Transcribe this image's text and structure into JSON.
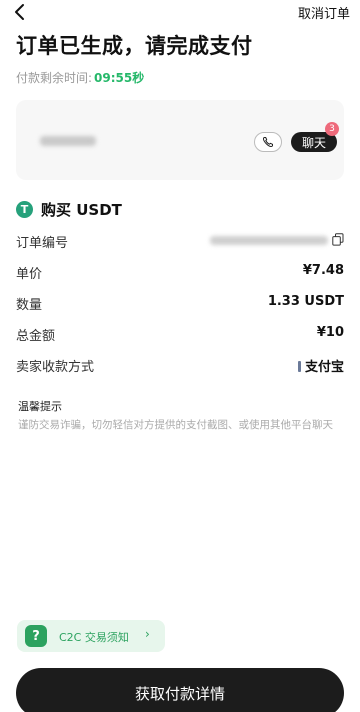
{
  "nav": {
    "back_icon": "chevron-left-icon",
    "cancel_label": "取消订单"
  },
  "header": {
    "title": "订单已生成，请完成支付",
    "timer_label": "付款剩余时间:",
    "timer_value": "09:55秒"
  },
  "seller": {
    "phone_icon": "phone-icon",
    "chat_label": "聊天",
    "chat_badge": "3"
  },
  "order": {
    "title": "购买 USDT",
    "asset_icon": "tether-icon",
    "asset_symbol": "T",
    "rows": [
      {
        "label": "订单编号",
        "value": ""
      },
      {
        "label": "单价",
        "value": "¥7.48"
      },
      {
        "label": "数量",
        "value": "1.33 USDT"
      },
      {
        "label": "总金额",
        "value": "¥10"
      },
      {
        "label": "卖家收款方式",
        "value": "支付宝"
      }
    ]
  },
  "tips": {
    "title": "温馨提示",
    "text": "谨防交易诈骗，切勿轻信对方提供的支付截图、或使用其他平台聊天"
  },
  "c2c": {
    "icon_symbol": "?",
    "label": "C2C 交易须知",
    "chevron": "›"
  },
  "action": {
    "primary_label": "获取付款详情"
  },
  "colors": {
    "accent_green": "#26b86a",
    "tether_green": "#26a17b",
    "dark_button": "#1c1c1c",
    "badge_pink": "#ee6a7b"
  }
}
